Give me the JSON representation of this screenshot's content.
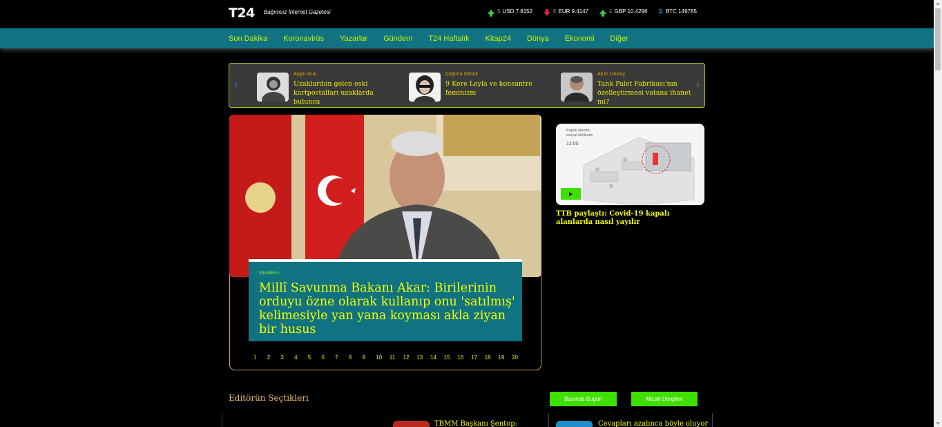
{
  "header": {
    "logo": "T24",
    "tagline": "Bağımsız İnternet Gazetesi",
    "rates": [
      {
        "symbol": "$",
        "label": "USD 7.8152",
        "direction": "up"
      },
      {
        "symbol": "€",
        "label": "EUR 9.4147",
        "direction": "down"
      },
      {
        "symbol": "£",
        "label": "GBP 10.4296",
        "direction": "up"
      },
      {
        "symbol": "₿",
        "label": "BTC 149785",
        "direction": "none"
      }
    ]
  },
  "nav": {
    "items": [
      "Son Dakika",
      "Koronavirüs",
      "Yazarlar",
      "Gündem",
      "T24 Haftalık",
      "Kitap24",
      "Dünya",
      "Ekonomi",
      "Diğer"
    ]
  },
  "columnists": [
    {
      "author": "Aygın Acar",
      "title": "Uzaklardan gelen eski kartpostalları uzaklarda bulunca"
    },
    {
      "author": "Çağıma Öztürk",
      "title": "9 Kere Leyla ve konsantre feminizm"
    },
    {
      "author": "Ali D. Ulusoy",
      "title": "Tank Palet Fabrikası'nın özelleştirmesi vatana ihanet mi?"
    }
  ],
  "hero": {
    "category": "Gündem ›",
    "title": "Millî Savunma Bakanı Akar: Birilerinin orduyu özne olarak kullanıp onu 'satılmış' kelimesiyle yan yana koyması akla ziyan bir husus",
    "pages": [
      "1",
      "2",
      "3",
      "4",
      "5",
      "6",
      "7",
      "8",
      "9",
      "10",
      "11",
      "12",
      "13",
      "14",
      "15",
      "16",
      "17",
      "18",
      "19",
      "20"
    ]
  },
  "side": {
    "image_label": "Kapalı alanda\nsosyal etkileşim",
    "image_time": "12:00",
    "title": "TTB paylaştı: Covid-19 kapalı alanlarda nasıl yayılır"
  },
  "editors": {
    "title": "Editörün Seçtikleri",
    "button1": "Basında Bugün",
    "button2": "Mizah Dergileri",
    "item1_title": "TBMM Başkanı Şentop:",
    "item2_title": "Cevapları azalınca böyle oluyor"
  },
  "colors": {
    "nav_bg": "#117381",
    "nav_text": "#c8f400",
    "headline_yellow": "#f4ff00",
    "accent_green": "#3ee000"
  }
}
